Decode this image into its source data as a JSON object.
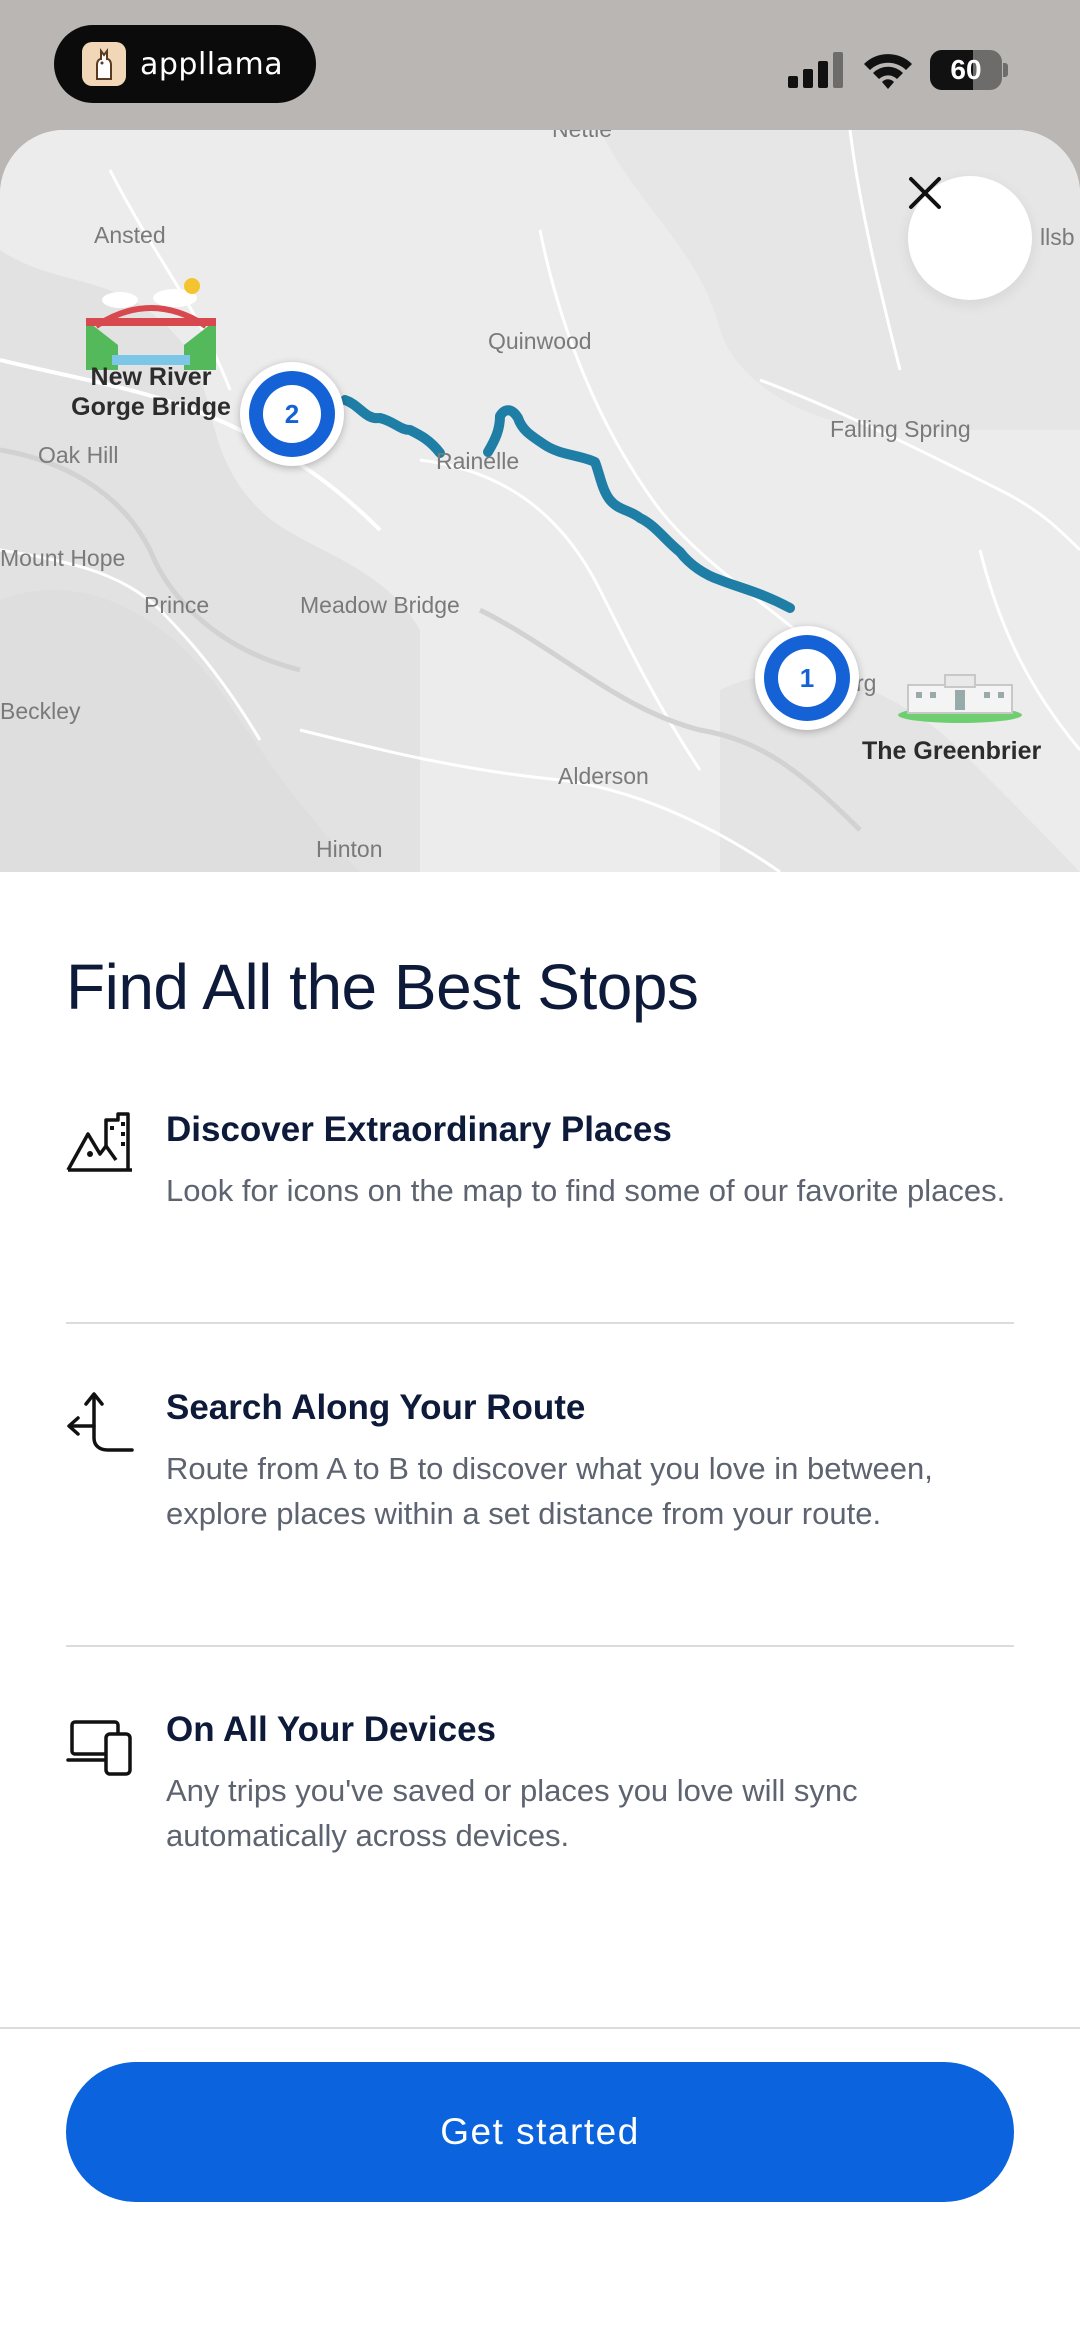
{
  "status_bar": {
    "app_pill_name": "appllama",
    "battery_level": "60",
    "battery_fraction": 0.6
  },
  "map": {
    "labels": {
      "ansted": "Ansted",
      "nettie": "Nettie",
      "quinwood": "Quinwood",
      "falling_spring": "Falling Spring",
      "oak_hill": "Oak Hill",
      "rainelle": "Rainelle",
      "mount_hope": "Mount Hope",
      "prince": "Prince",
      "meadow_bridge": "Meadow Bridge",
      "beckley": "Beckley",
      "alderson": "Alderson",
      "hinton": "Hinton",
      "lewisburg_partial": "rg",
      "hillsboro_partial": "llsb"
    },
    "poi": {
      "new_river_line1": "New River",
      "new_river_line2": "Gorge Bridge",
      "greenbrier": "The Greenbrier"
    },
    "pins": [
      {
        "number": "1"
      },
      {
        "number": "2"
      }
    ]
  },
  "title": "Find All the Best Stops",
  "features": [
    {
      "icon": "city-mountain-icon",
      "title": "Discover Extraordinary Places",
      "description": "Look for icons on the map to find some of our favorite places."
    },
    {
      "icon": "route-split-icon",
      "title": "Search Along Your Route",
      "description": "Route from A to B to discover what you love in between, explore places within a set distance from your route."
    },
    {
      "icon": "devices-icon",
      "title": "On All Your Devices",
      "description": "Any trips you've saved or places you love will sync automatically across devices."
    }
  ],
  "cta_label": "Get started",
  "colors": {
    "primary": "#0b63dd",
    "route": "#1f7ea6",
    "title": "#0d1a3a",
    "body": "#5d6470"
  }
}
